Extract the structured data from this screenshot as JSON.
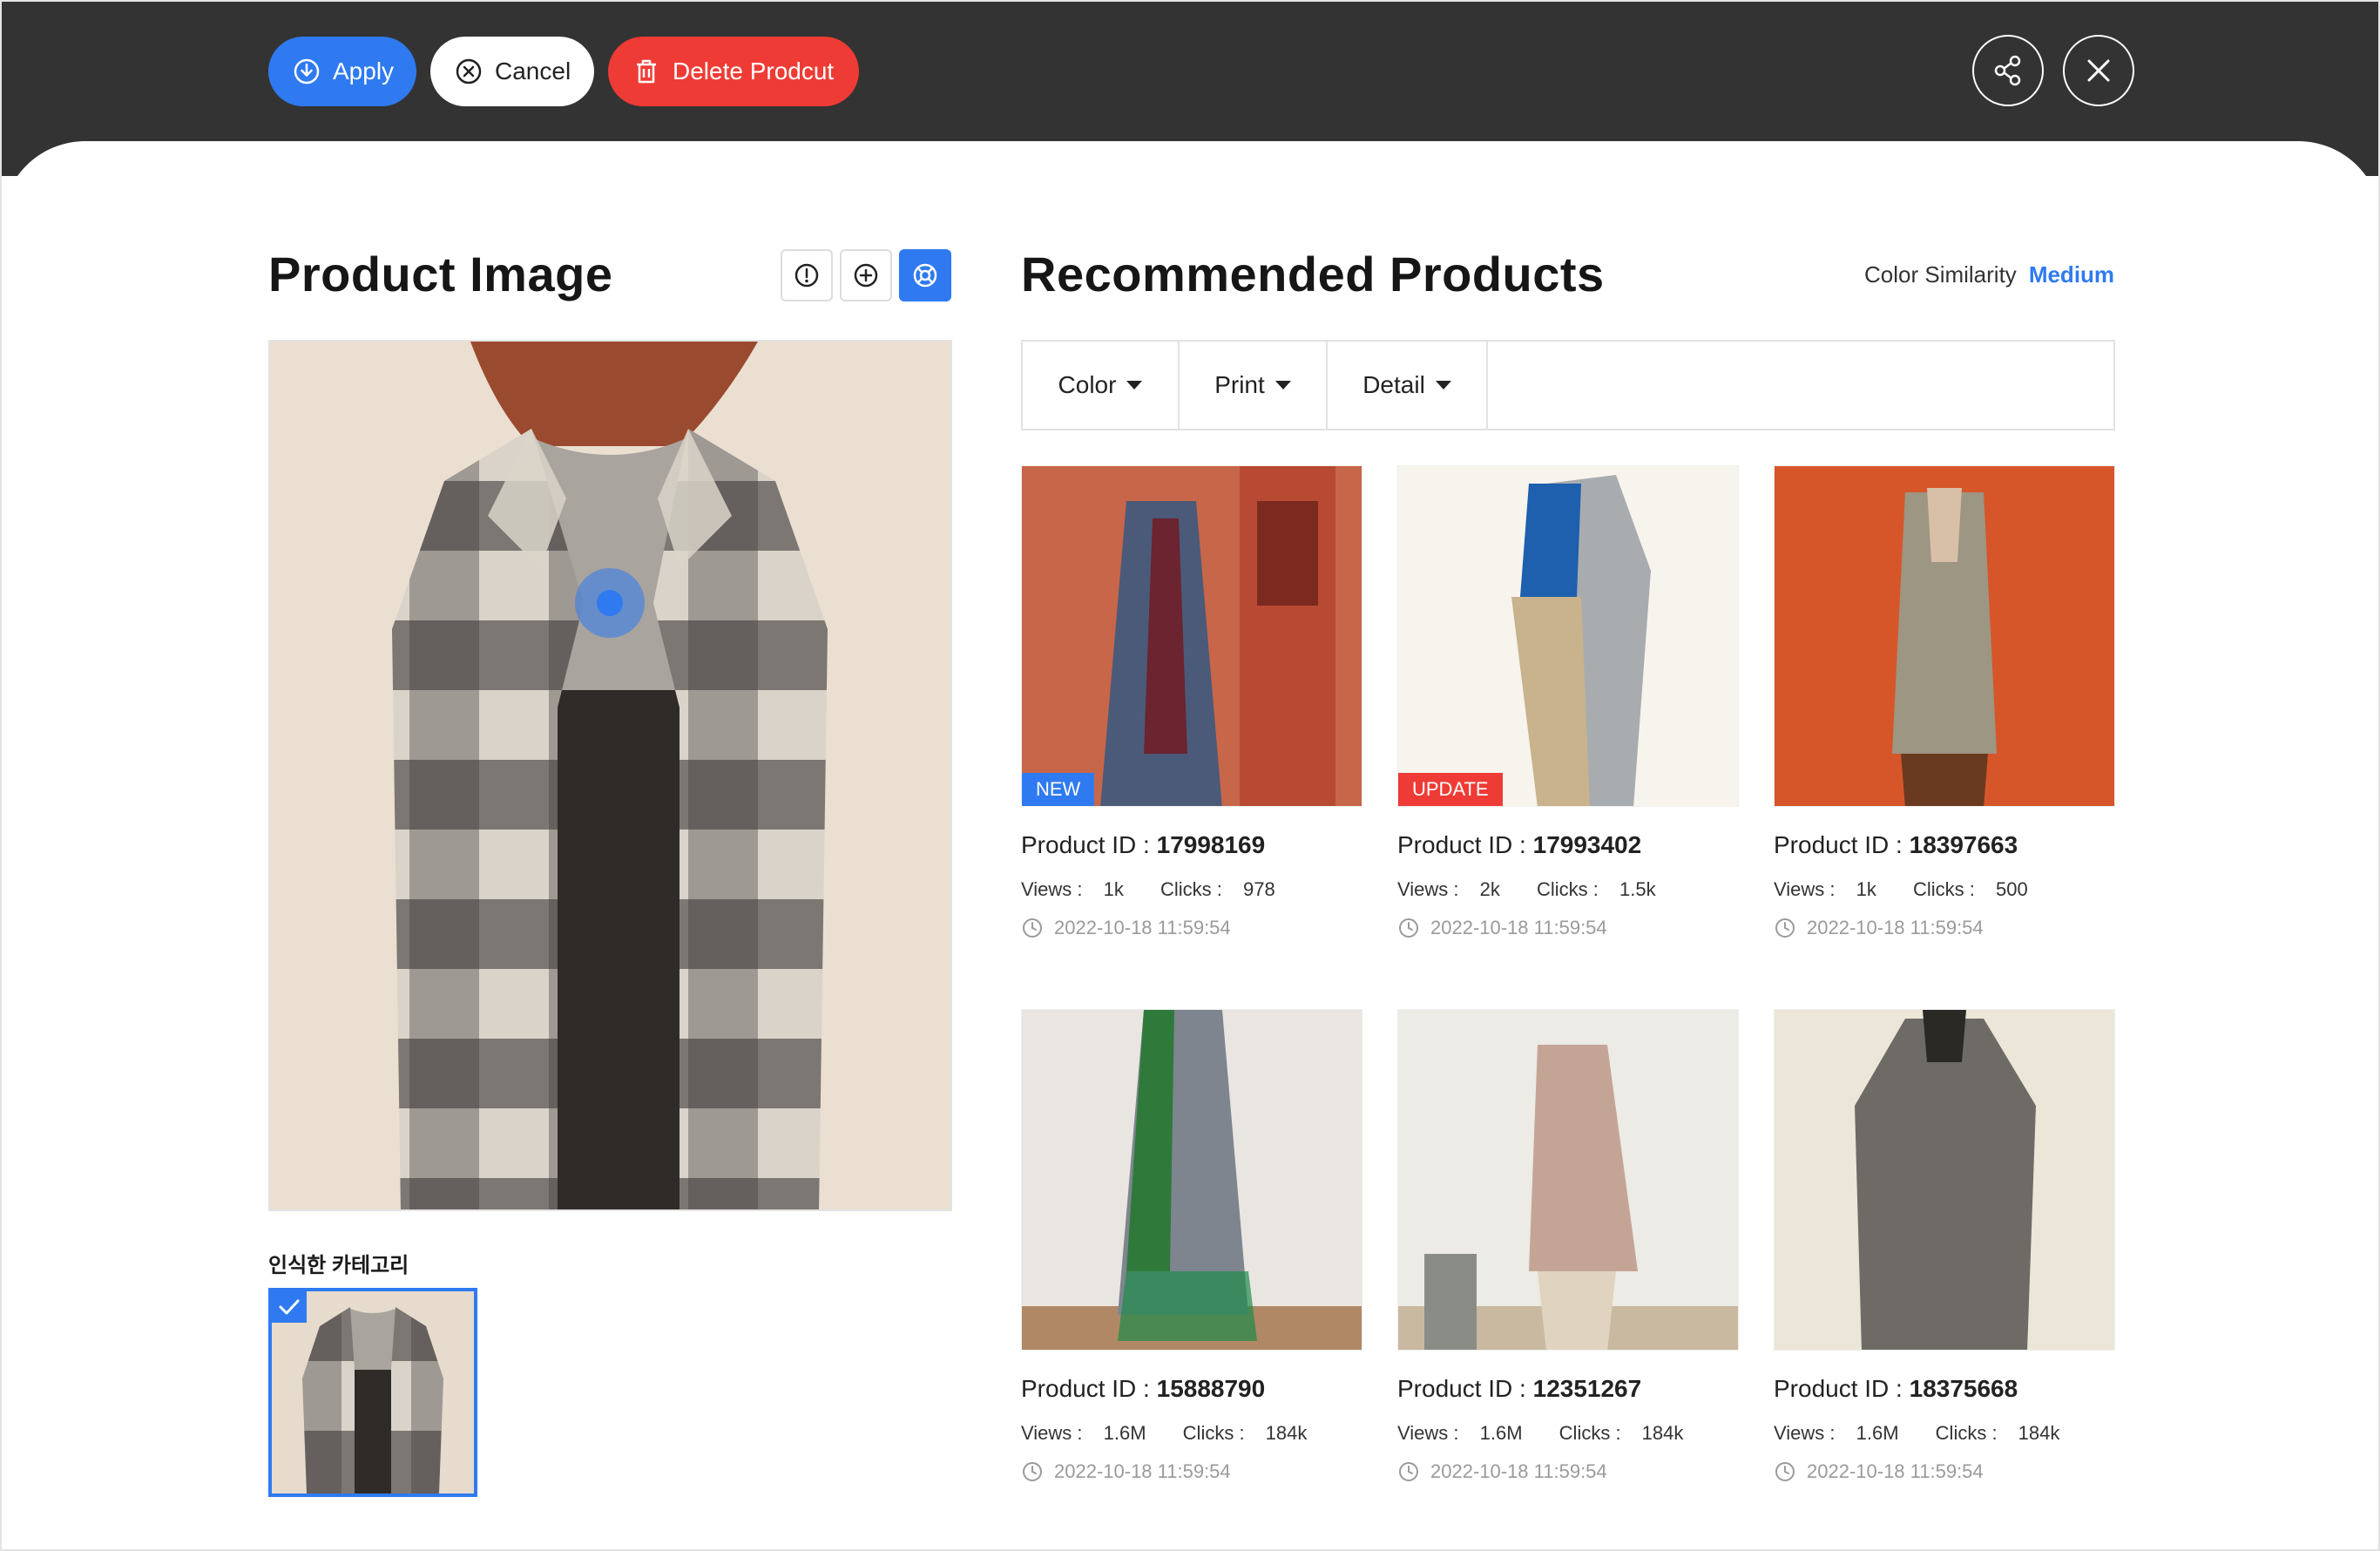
{
  "toolbar": {
    "apply_label": "Apply",
    "cancel_label": "Cancel",
    "delete_label": "Delete Prodcut"
  },
  "product_image": {
    "title": "Product Image",
    "category_label": "인식한 카테고리"
  },
  "recommended": {
    "title": "Recommended Products",
    "similarity_label": "Color Similarity",
    "similarity_value": "Medium",
    "filters": [
      "Color",
      "Print",
      "Detail"
    ],
    "products": [
      {
        "badge": "NEW",
        "id_label": "Product ID : ",
        "id": "17998169",
        "views_label": "Views : ",
        "views": "1k",
        "clicks_label": "Clicks : ",
        "clicks": "978",
        "time": "2022-10-18 11:59:54"
      },
      {
        "badge": "UPDATE",
        "id_label": "Product ID : ",
        "id": "17993402",
        "views_label": "Views : ",
        "views": "2k",
        "clicks_label": "Clicks : ",
        "clicks": "1.5k",
        "time": "2022-10-18 11:59:54"
      },
      {
        "badge": "",
        "id_label": "Product ID : ",
        "id": "18397663",
        "views_label": "Views : ",
        "views": "1k",
        "clicks_label": "Clicks : ",
        "clicks": "500",
        "time": "2022-10-18 11:59:54"
      },
      {
        "badge": "",
        "id_label": "Product ID : ",
        "id": "15888790",
        "views_label": "Views : ",
        "views": "1.6M",
        "clicks_label": "Clicks : ",
        "clicks": "184k",
        "time": "2022-10-18 11:59:54"
      },
      {
        "badge": "",
        "id_label": "Product ID : ",
        "id": "12351267",
        "views_label": "Views : ",
        "views": "1.6M",
        "clicks_label": "Clicks : ",
        "clicks": "184k",
        "time": "2022-10-18 11:59:54"
      },
      {
        "badge": "",
        "id_label": "Product ID : ",
        "id": "18375668",
        "views_label": "Views : ",
        "views": "1.6M",
        "clicks_label": "Clicks : ",
        "clicks": "184k",
        "time": "2022-10-18 11:59:54"
      }
    ]
  },
  "colors": {
    "topbar": "#333333",
    "accent": "#2f7af0",
    "danger": "#ef3b35"
  },
  "icons": {
    "apply": "download-circle-icon",
    "cancel": "x-circle-icon",
    "delete": "trash-icon",
    "share": "share-icon",
    "close": "close-icon",
    "info": "info-icon",
    "add": "plus-circle-icon",
    "target": "target-icon",
    "clock": "clock-icon",
    "check": "check-icon"
  }
}
